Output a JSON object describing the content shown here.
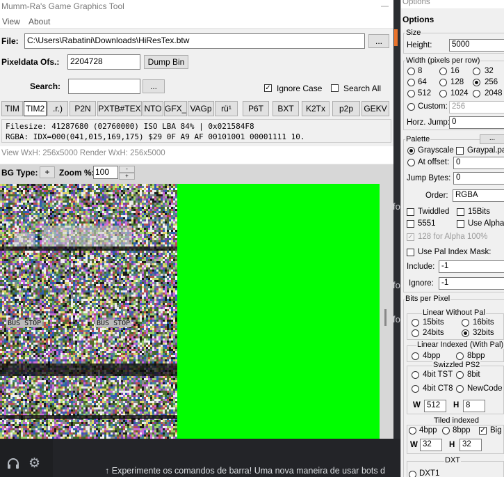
{
  "main": {
    "app_title": "Mumm-Ra's Game Graphics Tool",
    "menu": [
      "View",
      "About"
    ],
    "file_label": "File:",
    "file_path": "C:\\Users\\Rabatini\\Downloads\\HiResTex.btw",
    "browse_label": "...",
    "pixeldata_label": "Pixeldata Ofs.:",
    "pixeldata_value": "2204728",
    "dump_bin_label": "Dump Bin",
    "search_label": "Search:",
    "search_value": "",
    "search_btn_label": "...",
    "ignore_case_label": "Ignore Case",
    "ignore_case_checked": true,
    "search_all_label": "Search All",
    "search_all_checked": false,
    "formats": [
      "TIM",
      "TIM2",
      ".r.)",
      "P2N",
      "PXTB#TEX",
      "NTO",
      "GFX_",
      "VAGp",
      "rü¹",
      "P6T",
      "BXT",
      "K2Tx",
      "p2p",
      "GEKV"
    ],
    "selected_format": "TIM2",
    "filesize_line": "Filesize: 41287680 (02760000)   ISO LBA 84% | 0x021584F8",
    "rgba_line": "    RGBA: IDX=000(041,015,169,175) $29 0F A9 AF 00101001 00001111 10.",
    "view_info": "View WxH: 256x5000 Render WxH: 256x5000",
    "bg_type_label": "BG Type:",
    "bg_plus": "+",
    "zoom_label": "Zoom %:",
    "zoom_value": "100",
    "zoom_up": "-",
    "zoom_down": "+",
    "texture_text_1": "BUS STOP",
    "texture_text_2": "BUS STOP",
    "colors": {
      "preview_bg": "#00ff00",
      "noise_base": "#7c8a52"
    }
  },
  "discord": {
    "tip_text": "Experimente os comandos de barra! Uma nova maneira de usar bots d",
    "tip_arrow": "↑",
    "bg_fragments": [
      "fo",
      "fo",
      "fo"
    ],
    "headset_icon": "headset-icon",
    "settings_icon": "gear-icon"
  },
  "options": {
    "window_title": "Options",
    "heading": "Options",
    "size_group": "Size",
    "height_label": "Height:",
    "height_value": "5000",
    "width_group": "Width (pixels per row)",
    "width_options": [
      "8",
      "16",
      "32",
      "64",
      "128",
      "256",
      "512",
      "1024",
      "2048"
    ],
    "width_selected": "256",
    "custom_label": "Custom:",
    "custom_value": "256",
    "horz_jump_label": "Horz. Jump:",
    "horz_jump_value": "0",
    "palette_group": "Palette",
    "palette_btn": "...",
    "grayscale_label": "Grayscale",
    "graypal_label": "Graypal.pal",
    "at_offset_label": "At offset:",
    "at_offset_value": "0",
    "jump_bytes_label": "Jump Bytes:",
    "jump_bytes_value": "0",
    "order_label": "Order:",
    "order_value": "RGBA",
    "twiddled_label": "Twiddled",
    "bits15_label": "15Bits",
    "c5551_label": "5551",
    "use_alpha_label": "Use Alpha",
    "alpha100_label": "128 for Alpha 100%",
    "use_pal_mask_label": "Use Pal Index Mask:",
    "include_label": "Include:",
    "include_value": "-1",
    "ignore_label": "Ignore:",
    "ignore_value": "-1",
    "bpp_group": "Bits per Pixel",
    "linear_nopal_group": "Linear Without Pal",
    "b15": "15bits",
    "b16": "16bits",
    "b24": "24bits",
    "b32": "32bits",
    "linear_idx_group": "Linear Indexed (With Pal)",
    "li_4bpp": "4bpp",
    "li_8bpp": "8bpp",
    "swizzled_group": "Swizzled PS2",
    "sw_4bit_tst": "4bit TST",
    "sw_8bit": "8bit",
    "sw_4bit_ct8": "4bit CT8",
    "sw_newcode": "NewCode",
    "sw_w_label": "W",
    "sw_w_value": "512",
    "sw_h_label": "H",
    "sw_h_value": "8",
    "tiled_group": "Tiled indexed",
    "ti_4bpp": "4bpp",
    "ti_8bpp": "8bpp",
    "ti_big": "Big",
    "ti_w_label": "W",
    "ti_w_value": "32",
    "ti_h_label": "H",
    "ti_h_value": "32",
    "dxt_group": "DXT",
    "dxt1_label": "DXT1"
  }
}
